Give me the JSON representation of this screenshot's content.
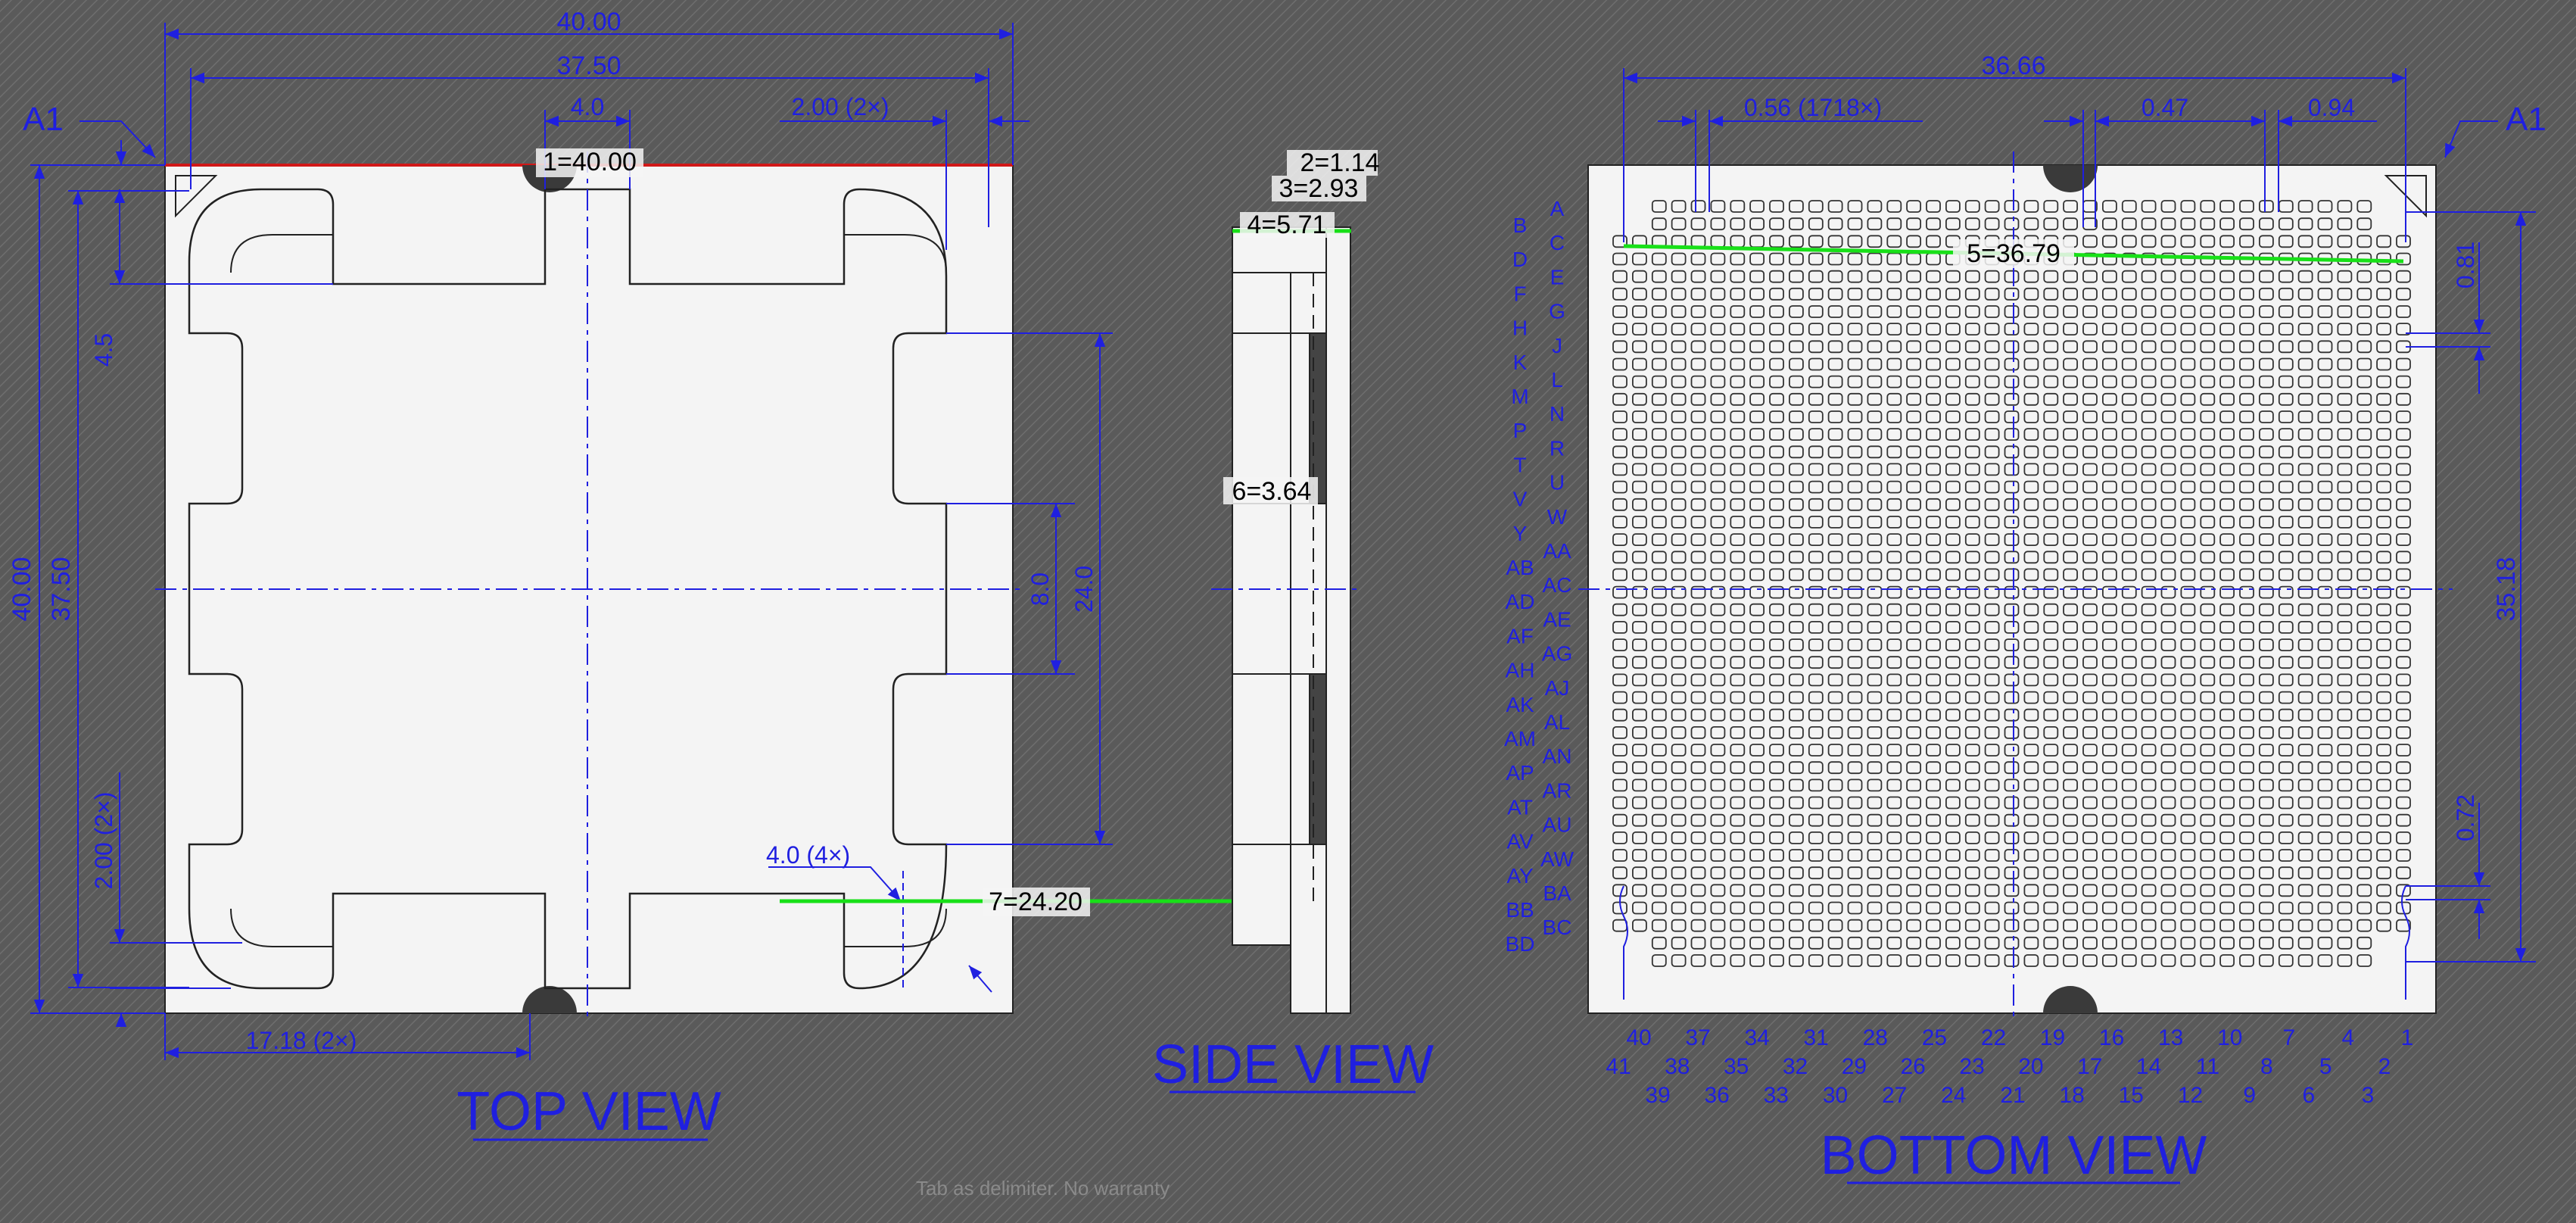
{
  "colors": {
    "background": "#5a5a5a",
    "hatch": "#6a6a6a",
    "paper": "#f4f4f4",
    "dimension": "#1f1fe0",
    "measure": "#18e018",
    "edge": "#d01818",
    "outline": "#222222"
  },
  "views": {
    "top": "TOP VIEW",
    "side": "SIDE VIEW",
    "bottom": "BOTTOM VIEW"
  },
  "top_dims": {
    "width_40": "40.00",
    "width_375": "37.50",
    "notch_40": "4.0",
    "tab_200": "2.00 (2×)",
    "height_40": "40.00",
    "height_375": "37.50",
    "side_45": "4.5",
    "left_200": "2.00 (2×)",
    "bottom_1718": "17.18 (2×)",
    "tab_80": "8.0",
    "tab_240": "24.0",
    "radius_40": "4.0 (4×)",
    "a1": "A1"
  },
  "measurements": {
    "m1": "1=40.00",
    "m2": "2=1.14",
    "m3": "3=2.93",
    "m4": "4=5.71",
    "m5": "5=36.79",
    "m6": "6=3.64",
    "m7": "7=24.20"
  },
  "bottom_dims": {
    "width_3666": "36.66",
    "pitch_056": "0.56 (1718×)",
    "gap_047": "0.47",
    "gap_094": "0.94",
    "right_081": "0.81",
    "right_3518": "35.18",
    "right_072": "0.72",
    "a1": "A1"
  },
  "row_labels_left": [
    "B",
    "D",
    "F",
    "H",
    "K",
    "M",
    "P",
    "T",
    "V",
    "Y",
    "AB",
    "AD",
    "AF",
    "AH",
    "AK",
    "AM",
    "AP",
    "AT",
    "AV",
    "AY",
    "BB",
    "BD"
  ],
  "row_labels_right": [
    "A",
    "C",
    "E",
    "G",
    "J",
    "L",
    "N",
    "R",
    "U",
    "W",
    "AA",
    "AC",
    "AE",
    "AG",
    "AJ",
    "AL",
    "AN",
    "AR",
    "AU",
    "AW",
    "BA",
    "BC"
  ],
  "col_labels_row1": [
    "40",
    "37",
    "34",
    "31",
    "28",
    "25",
    "22",
    "19",
    "16",
    "13",
    "10",
    "7",
    "4",
    "1"
  ],
  "col_labels_row2": [
    "41",
    "38",
    "35",
    "32",
    "29",
    "26",
    "23",
    "20",
    "17",
    "14",
    "11",
    "8",
    "5",
    "2"
  ],
  "col_labels_row3": [
    "39",
    "36",
    "33",
    "30",
    "27",
    "24",
    "21",
    "18",
    "15",
    "12",
    "9",
    "6",
    "3"
  ],
  "footer": "Tab as delimiter. No warranty"
}
